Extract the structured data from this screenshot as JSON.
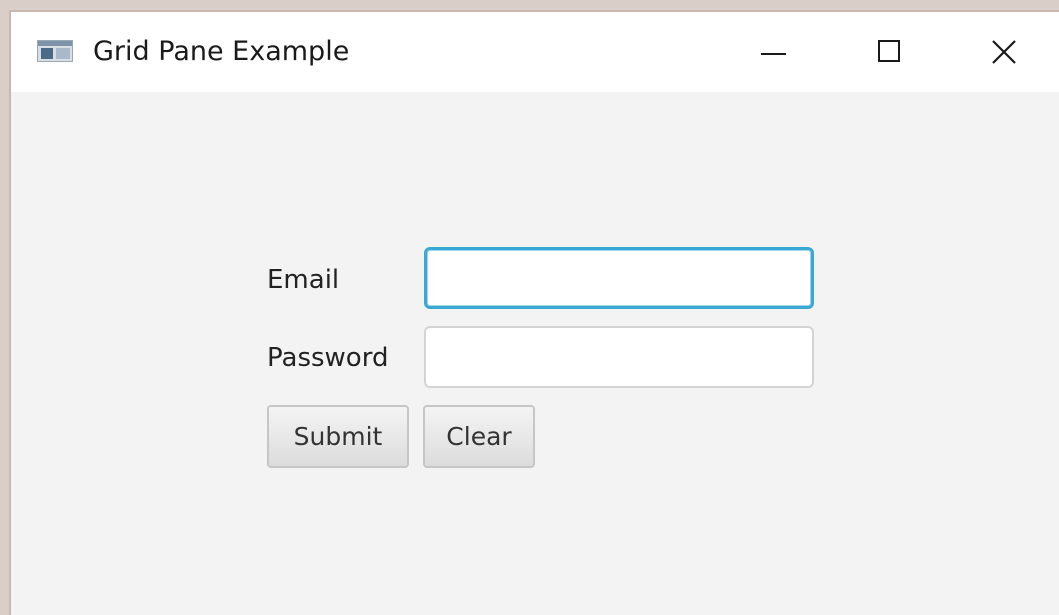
{
  "window": {
    "title": "Grid Pane Example",
    "icons": {
      "app": "app-window-icon",
      "minimize": "minimize-icon",
      "maximize": "maximize-icon",
      "close": "close-icon"
    }
  },
  "form": {
    "email_label": "Email",
    "email_value": "",
    "password_label": "Password",
    "password_value": "",
    "submit_label": "Submit",
    "clear_label": "Clear"
  },
  "colors": {
    "focus_border": "#39a9d4",
    "background": "#f3f3f3",
    "titlebar": "#ffffff"
  }
}
